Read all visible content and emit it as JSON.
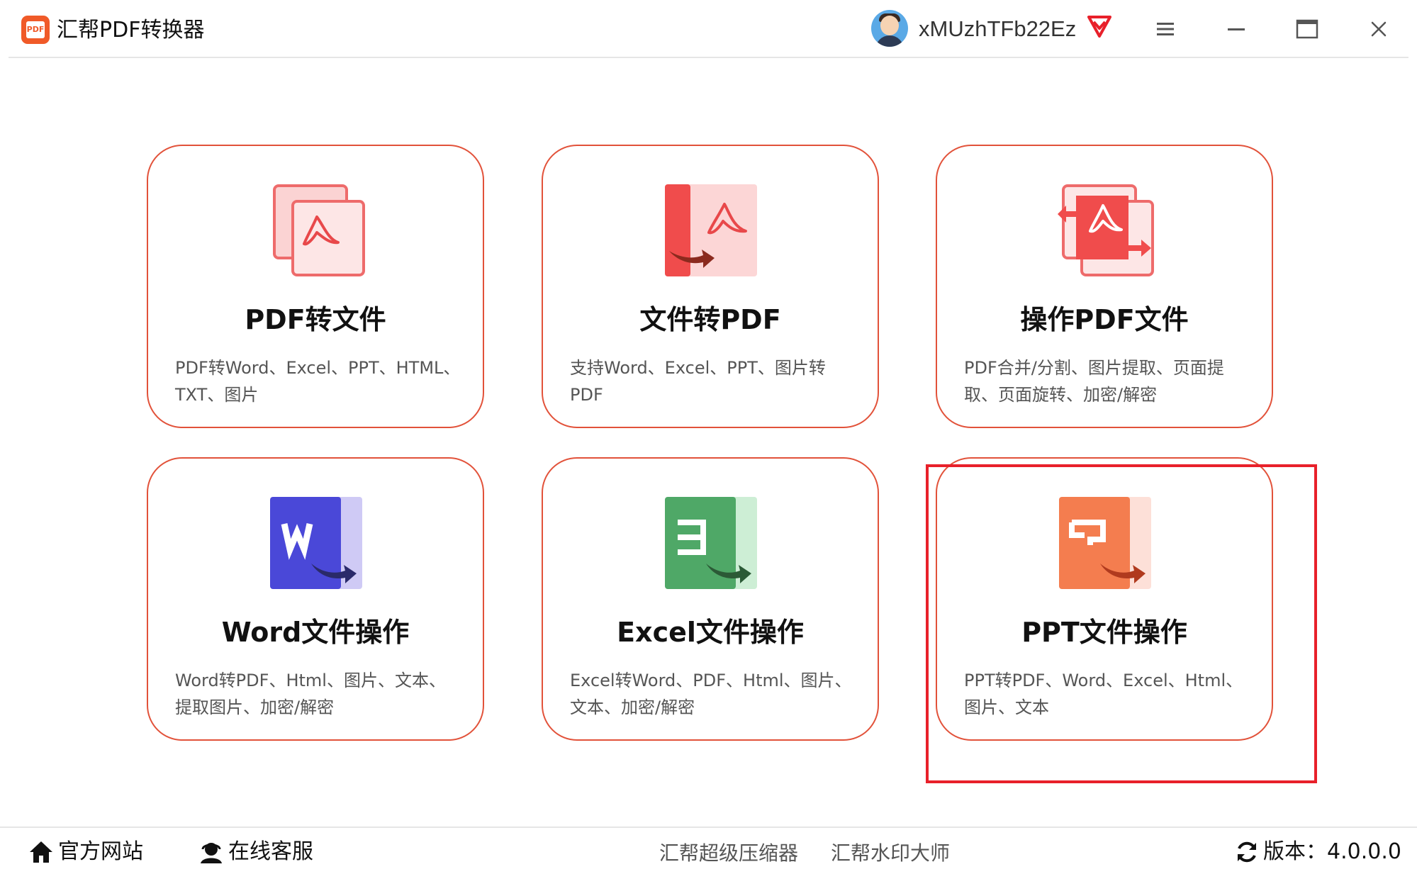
{
  "app": {
    "title": "汇帮PDF转换器",
    "logo_text": "PDF",
    "brand_color": "#f05a28"
  },
  "user": {
    "name": "xMUzhTFb22Ez",
    "vip_icon": "vip-diamond-icon",
    "avatar": "avatar-icon"
  },
  "window_controls": {
    "menu": "menu-icon",
    "minimize": "minimize-icon",
    "maximize": "maximize-icon",
    "close": "close-icon"
  },
  "cards": [
    {
      "title": "PDF转文件",
      "desc": "PDF转Word、Excel、PPT、HTML、TXT、图片",
      "icon": "pdf-to-file-icon"
    },
    {
      "title": "文件转PDF",
      "desc": "支持Word、Excel、PPT、图片转PDF",
      "icon": "file-to-pdf-icon"
    },
    {
      "title": "操作PDF文件",
      "desc": "PDF合并/分割、图片提取、页面提取、页面旋转、加密/解密",
      "icon": "pdf-operations-icon"
    },
    {
      "title": "Word文件操作",
      "desc": "Word转PDF、Html、图片、文本、提取图片、加密/解密",
      "icon": "word-file-icon"
    },
    {
      "title": "Excel文件操作",
      "desc": "Excel转Word、PDF、Html、图片、文本、加密/解密",
      "icon": "excel-file-icon"
    },
    {
      "title": "PPT文件操作",
      "desc": "PPT转PDF、Word、Excel、Html、图片、文本",
      "icon": "ppt-file-icon"
    }
  ],
  "highlight_color": "#e8202a",
  "footer": {
    "website": "官方网站",
    "support": "在线客服",
    "compressor": "汇帮超级压缩器",
    "watermark": "汇帮水印大师",
    "version": "版本：4.0.0.0"
  }
}
